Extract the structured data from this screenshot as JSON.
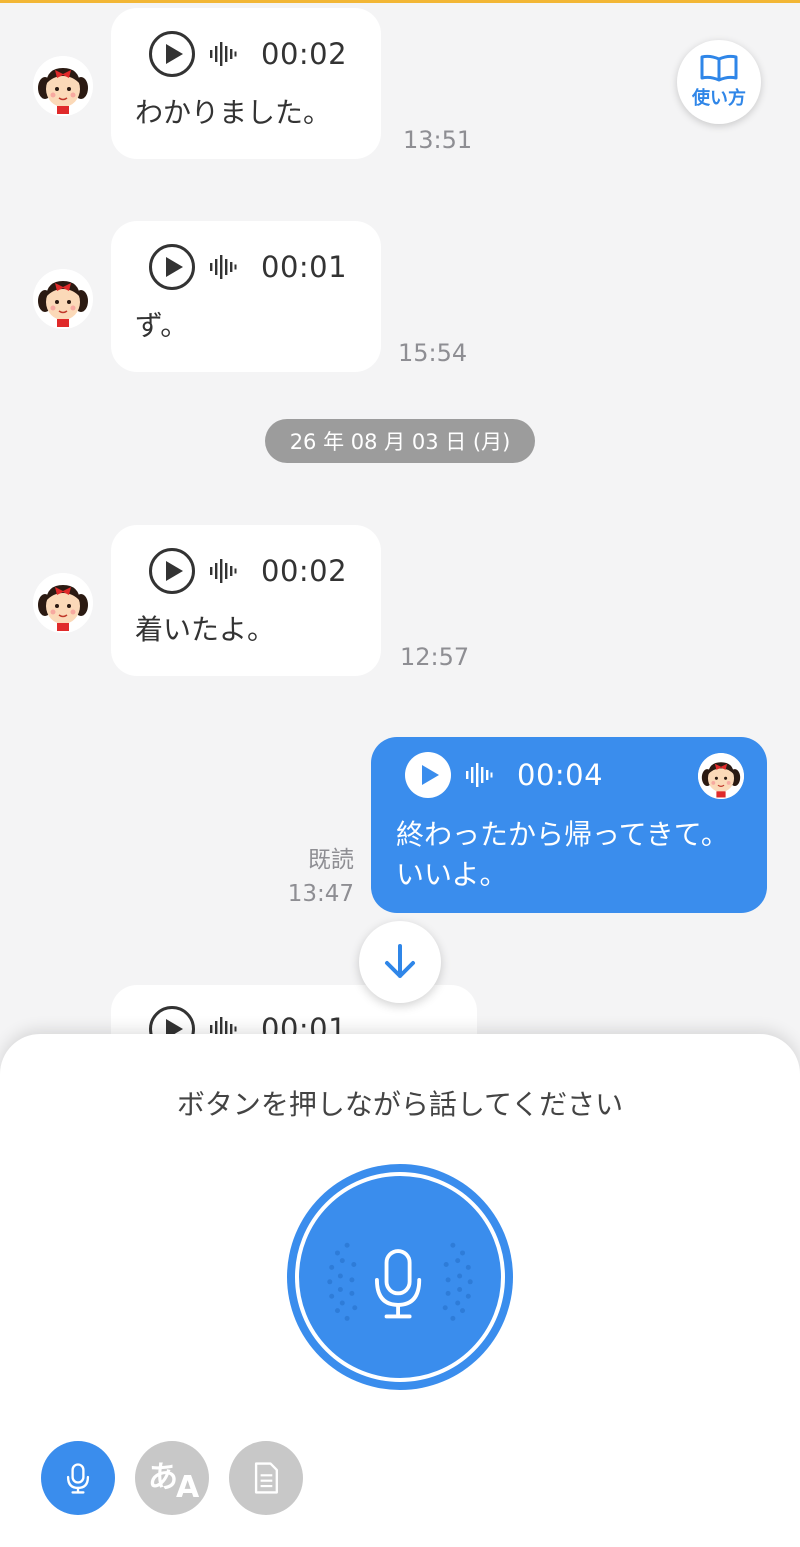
{
  "help": {
    "label": "使い方",
    "icon": "book-icon"
  },
  "messages": [
    {
      "duration": "00:02",
      "text": "わかりました。",
      "time": "13:51"
    },
    {
      "duration": "00:01",
      "text": "ず。",
      "time": "15:54"
    },
    {
      "duration": "00:02",
      "text": "着いたよ。",
      "time": "12:57"
    },
    {
      "duration": "00:04",
      "text_line1": "終わったから帰ってきて。",
      "text_line2": "いいよ。",
      "read": "既読",
      "time": "13:47"
    },
    {
      "duration": "00:01"
    }
  ],
  "date_separator": "26 年 08 月 03 日 (月)",
  "panel": {
    "hint": "ボタンを押しながら話してください"
  },
  "modes": [
    {
      "name": "voice",
      "icon": "mic-icon",
      "active": true
    },
    {
      "name": "translate",
      "icon": "translate-icon",
      "label": "あ",
      "sub": "A",
      "active": false
    },
    {
      "name": "text",
      "icon": "document-icon",
      "active": false
    }
  ],
  "colors": {
    "accent": "#3a8ded",
    "background": "#f4f4f5",
    "top_border": "#f2b635",
    "inactive": "#c8c8c8"
  }
}
